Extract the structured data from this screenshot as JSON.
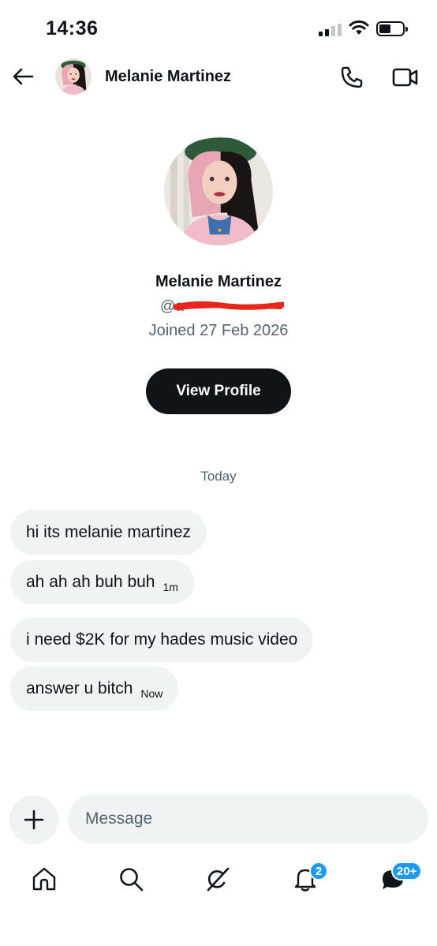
{
  "status_bar": {
    "time": "14:36"
  },
  "header": {
    "title": "Melanie Martinez"
  },
  "profile": {
    "name": "Melanie Martinez",
    "handle_prefix": "@a",
    "joined": "Joined 27 Feb 2026",
    "view_profile_label": "View Profile"
  },
  "conversation": {
    "date_separator": "Today",
    "messages": [
      {
        "text": "hi its melanie martinez",
        "time": ""
      },
      {
        "text": "ah ah ah buh buh",
        "time": "1m"
      },
      {
        "text": "i need $2K for my hades music video",
        "time": ""
      },
      {
        "text": "answer u bitch",
        "time": "Now"
      }
    ]
  },
  "composer": {
    "placeholder": "Message"
  },
  "bottom_nav": {
    "items": [
      {
        "icon": "home-icon"
      },
      {
        "icon": "search-icon"
      },
      {
        "icon": "grok-icon"
      },
      {
        "icon": "bell-icon",
        "badge": "2"
      },
      {
        "icon": "messages-icon",
        "badge": "20+"
      }
    ]
  },
  "colors": {
    "text": "#0f1419",
    "secondary_text": "#536471",
    "bubble_bg": "#eff3f4",
    "accent": "#1d9bf0",
    "redaction": "#e8261a"
  }
}
